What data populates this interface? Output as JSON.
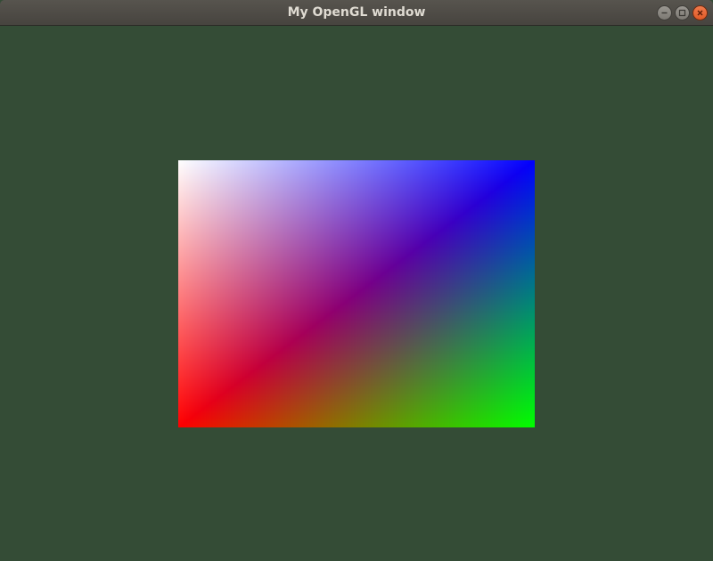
{
  "window": {
    "title": "My OpenGL window",
    "background_color": "#344c36"
  },
  "titlebar": {
    "controls": [
      {
        "name": "minimize",
        "icon": "minimize-icon"
      },
      {
        "name": "maximize",
        "icon": "maximize-icon"
      },
      {
        "name": "close",
        "icon": "close-icon"
      }
    ]
  },
  "scene": {
    "shape": "rectangle",
    "vertex_colors": {
      "top_left": "#ffffff",
      "top_right": "#0000ff",
      "bottom_left": "#ff0000",
      "bottom_right": "#00ff00"
    }
  }
}
